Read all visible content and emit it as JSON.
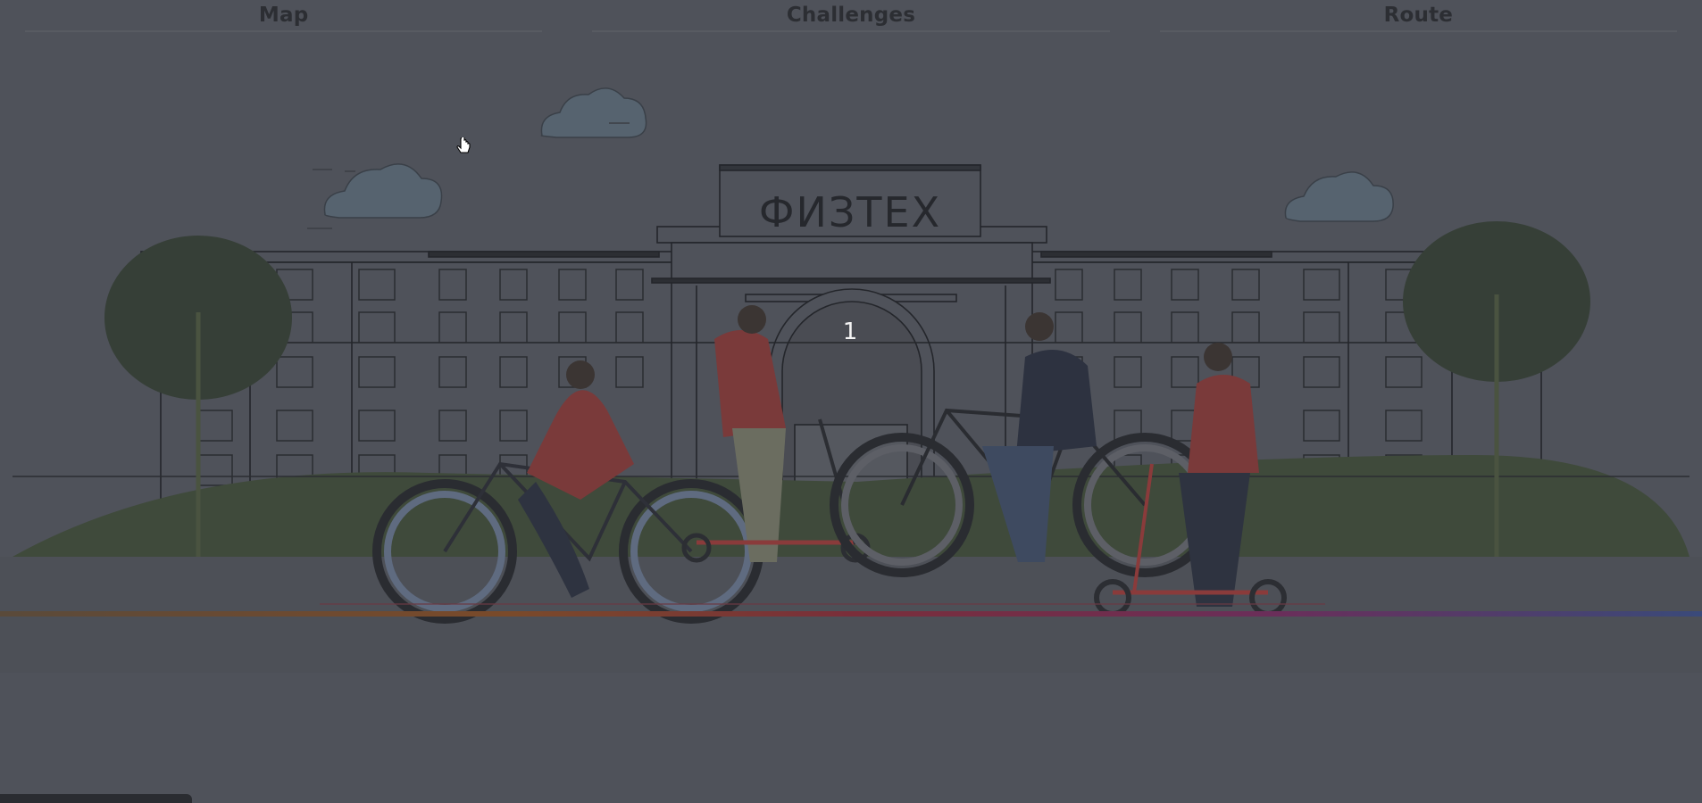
{
  "tabs": [
    {
      "label": "Map"
    },
    {
      "label": "Challenges"
    },
    {
      "label": "Route"
    }
  ],
  "illustration": {
    "building_sign": "ФИЗТЕХ",
    "step_number": "1"
  },
  "colors": {
    "overlay": "#4f525a",
    "ground_green": "#3f4a3b",
    "accent_red": "#8a3b3b",
    "tab_text": "#2c2e33"
  }
}
